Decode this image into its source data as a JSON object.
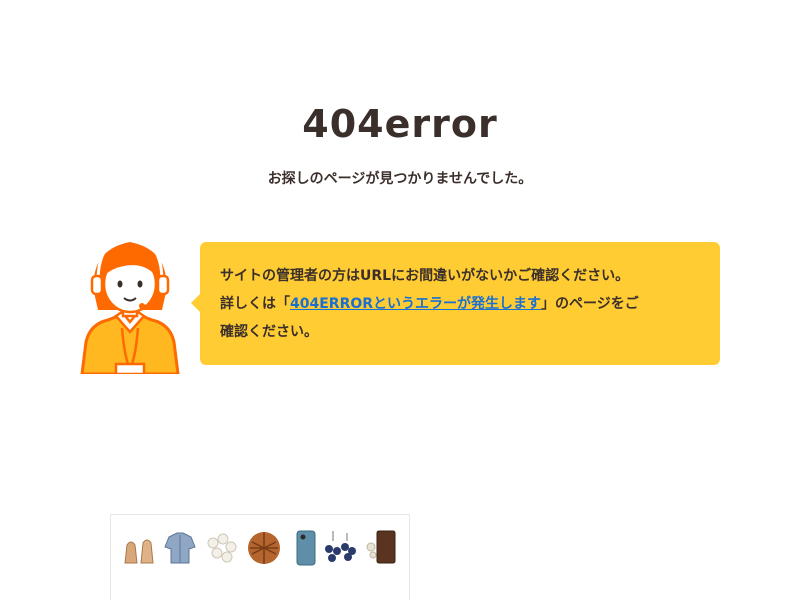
{
  "page": {
    "title": "404error",
    "subtitle": "お探しのページが見つかりませんでした。"
  },
  "message": {
    "line1": "サイトの管理者の方はURLにお間違いがないかご確認ください。",
    "line2_prefix": "詳しくは「",
    "link_label": "404ERRORというエラーが発生します",
    "line2_suffix": "」のページをご",
    "line3": "確認ください。"
  },
  "colors": {
    "bubble": "#ffcd33",
    "text": "#3b2f2b",
    "link": "#1a6fd1",
    "avatar_accent": "#ff6a00"
  },
  "banner": {
    "items": [
      {
        "icon": "shoes-icon"
      },
      {
        "icon": "shirt-icon"
      },
      {
        "icon": "buttons-icon"
      },
      {
        "icon": "pie-icon"
      },
      {
        "icon": "phone-case-icon"
      },
      {
        "icon": "earrings-icon"
      },
      {
        "icon": "wallet-icon"
      }
    ]
  }
}
